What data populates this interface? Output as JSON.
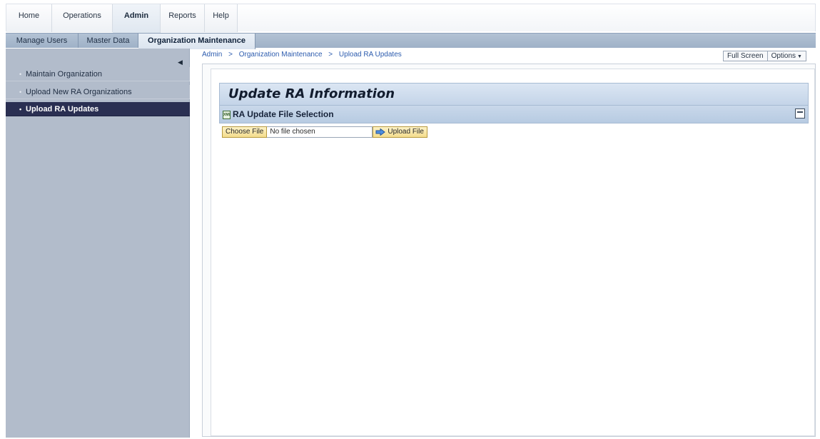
{
  "top_tabs": [
    {
      "label": "Home"
    },
    {
      "label": "Operations"
    },
    {
      "label": "Admin",
      "active": true
    },
    {
      "label": "Reports"
    },
    {
      "label": "Help"
    }
  ],
  "sub_tabs": [
    {
      "label": "Manage Users"
    },
    {
      "label": "Master Data"
    },
    {
      "label": "Organization Maintenance",
      "active": true
    }
  ],
  "sidebar": {
    "items": [
      {
        "label": "Maintain Organization"
      },
      {
        "label": "Upload New RA Organizations"
      },
      {
        "label": "Upload RA Updates",
        "active": true
      }
    ]
  },
  "breadcrumb": {
    "items": [
      "Admin",
      "Organization Maintenance",
      "Upload RA Updates"
    ],
    "separator": ">"
  },
  "toolbar": {
    "full_screen_label": "Full Screen",
    "options_label": "Options"
  },
  "page": {
    "title": "Update RA Information",
    "section_title": "RA Update File Selection",
    "section_icon": "xml-file-icon",
    "choose_file_label": "Choose File",
    "file_chosen_text": "No file chosen",
    "upload_label": "Upload File"
  },
  "colors": {
    "active_nav": "#2a2f52",
    "sidebar_bg": "#b2bccb",
    "section_header": "#c4d4e8",
    "button_yellow": "#f4dd8d",
    "link_blue": "#2d5cae"
  }
}
